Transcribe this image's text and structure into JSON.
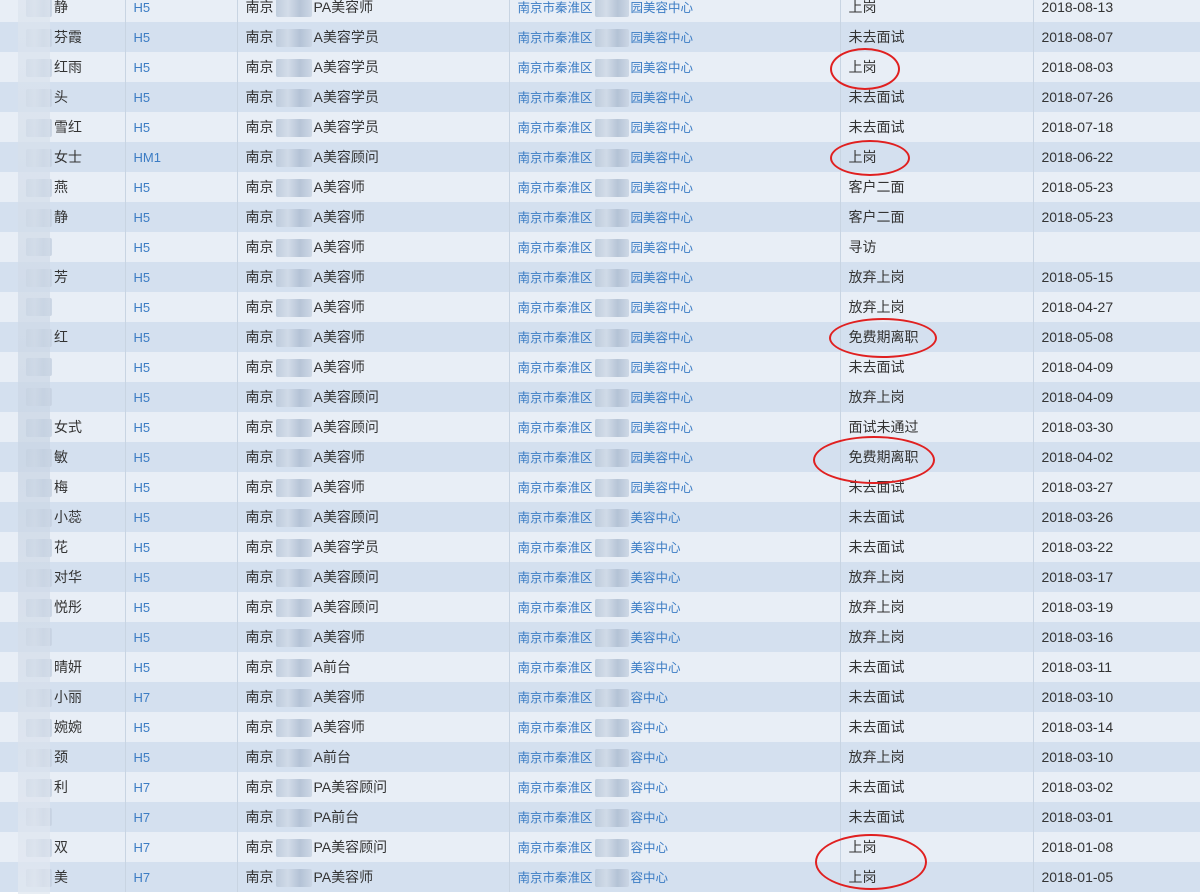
{
  "table": {
    "rows": [
      {
        "name": "静",
        "code": "H5",
        "pos_a": "南京",
        "pos_b": "PA美容师",
        "store_a": "南京市秦淮区",
        "store_b": "园美容中心",
        "status": "上岗",
        "date": "2018-08-13"
      },
      {
        "name": "芬霞",
        "code": "H5",
        "pos_a": "南京",
        "pos_b": "A美容学员",
        "store_a": "南京市秦淮区",
        "store_b": "园美容中心",
        "status": "未去面试",
        "date": "2018-08-07"
      },
      {
        "name": "红雨",
        "code": "H5",
        "pos_a": "南京",
        "pos_b": "A美容学员",
        "store_a": "南京市秦淮区",
        "store_b": "园美容中心",
        "status": "上岗",
        "date": "2018-08-03"
      },
      {
        "name": "头",
        "code": "H5",
        "pos_a": "南京",
        "pos_b": "A美容学员",
        "store_a": "南京市秦淮区",
        "store_b": "园美容中心",
        "status": "未去面试",
        "date": "2018-07-26"
      },
      {
        "name": "雪红",
        "code": "H5",
        "pos_a": "南京",
        "pos_b": "A美容学员",
        "store_a": "南京市秦淮区",
        "store_b": "园美容中心",
        "status": "未去面试",
        "date": "2018-07-18"
      },
      {
        "name": "女士",
        "code": "HM1",
        "pos_a": "南京",
        "pos_b": "A美容顾问",
        "store_a": "南京市秦淮区",
        "store_b": "园美容中心",
        "status": "上岗",
        "date": "2018-06-22"
      },
      {
        "name": "燕",
        "code": "H5",
        "pos_a": "南京",
        "pos_b": "A美容师",
        "store_a": "南京市秦淮区",
        "store_b": "园美容中心",
        "status": "客户二面",
        "date": "2018-05-23"
      },
      {
        "name": "静",
        "code": "H5",
        "pos_a": "南京",
        "pos_b": "A美容师",
        "store_a": "南京市秦淮区",
        "store_b": "园美容中心",
        "status": "客户二面",
        "date": "2018-05-23"
      },
      {
        "name": "",
        "code": "H5",
        "pos_a": "南京",
        "pos_b": "A美容师",
        "store_a": "南京市秦淮区",
        "store_b": "园美容中心",
        "status": "寻访",
        "date": ""
      },
      {
        "name": "芳",
        "code": "H5",
        "pos_a": "南京",
        "pos_b": "A美容师",
        "store_a": "南京市秦淮区",
        "store_b": "园美容中心",
        "status": "放弃上岗",
        "date": "2018-05-15"
      },
      {
        "name": "",
        "code": "H5",
        "pos_a": "南京",
        "pos_b": "A美容师",
        "store_a": "南京市秦淮区",
        "store_b": "园美容中心",
        "status": "放弃上岗",
        "date": "2018-04-27"
      },
      {
        "name": "红",
        "code": "H5",
        "pos_a": "南京",
        "pos_b": "A美容师",
        "store_a": "南京市秦淮区",
        "store_b": "园美容中心",
        "status": "免费期离职",
        "date": "2018-05-08"
      },
      {
        "name": "",
        "code": "H5",
        "pos_a": "南京",
        "pos_b": "A美容师",
        "store_a": "南京市秦淮区",
        "store_b": "园美容中心",
        "status": "未去面试",
        "date": "2018-04-09"
      },
      {
        "name": "",
        "code": "H5",
        "pos_a": "南京",
        "pos_b": "A美容顾问",
        "store_a": "南京市秦淮区",
        "store_b": "园美容中心",
        "status": "放弃上岗",
        "date": "2018-04-09"
      },
      {
        "name": "女式",
        "code": "H5",
        "pos_a": "南京",
        "pos_b": "A美容顾问",
        "store_a": "南京市秦淮区",
        "store_b": "园美容中心",
        "status": "面试未通过",
        "date": "2018-03-30"
      },
      {
        "name": "敏",
        "code": "H5",
        "pos_a": "南京",
        "pos_b": "A美容师",
        "store_a": "南京市秦淮区",
        "store_b": "园美容中心",
        "status": "免费期离职",
        "date": "2018-04-02"
      },
      {
        "name": "梅",
        "code": "H5",
        "pos_a": "南京",
        "pos_b": "A美容师",
        "store_a": "南京市秦淮区",
        "store_b": "园美容中心",
        "status": "未去面试",
        "date": "2018-03-27"
      },
      {
        "name": "小蕊",
        "code": "H5",
        "pos_a": "南京",
        "pos_b": "A美容顾问",
        "store_a": "南京市秦淮区",
        "store_b": "美容中心",
        "status": "未去面试",
        "date": "2018-03-26"
      },
      {
        "name": "花",
        "code": "H5",
        "pos_a": "南京",
        "pos_b": "A美容学员",
        "store_a": "南京市秦淮区",
        "store_b": "美容中心",
        "status": "未去面试",
        "date": "2018-03-22"
      },
      {
        "name": "对华",
        "code": "H5",
        "pos_a": "南京",
        "pos_b": "A美容顾问",
        "store_a": "南京市秦淮区",
        "store_b": "美容中心",
        "status": "放弃上岗",
        "date": "2018-03-17"
      },
      {
        "name": "悦彤",
        "code": "H5",
        "pos_a": "南京",
        "pos_b": "A美容顾问",
        "store_a": "南京市秦淮区",
        "store_b": "美容中心",
        "status": "放弃上岗",
        "date": "2018-03-19"
      },
      {
        "name": "",
        "code": "H5",
        "pos_a": "南京",
        "pos_b": "A美容师",
        "store_a": "南京市秦淮区",
        "store_b": "美容中心",
        "status": "放弃上岗",
        "date": "2018-03-16"
      },
      {
        "name": "晴妍",
        "code": "H5",
        "pos_a": "南京",
        "pos_b": "A前台",
        "store_a": "南京市秦淮区",
        "store_b": "美容中心",
        "status": "未去面试",
        "date": "2018-03-11"
      },
      {
        "name": "小丽",
        "code": "H7",
        "pos_a": "南京",
        "pos_b": "A美容师",
        "store_a": "南京市秦淮区",
        "store_b": "容中心",
        "status": "未去面试",
        "date": "2018-03-10"
      },
      {
        "name": "婉婉",
        "code": "H5",
        "pos_a": "南京",
        "pos_b": "A美容师",
        "store_a": "南京市秦淮区",
        "store_b": "容中心",
        "status": "未去面试",
        "date": "2018-03-14"
      },
      {
        "name": "颈",
        "code": "H5",
        "pos_a": "南京",
        "pos_b": "A前台",
        "store_a": "南京市秦淮区",
        "store_b": "容中心",
        "status": "放弃上岗",
        "date": "2018-03-10"
      },
      {
        "name": "利",
        "code": "H7",
        "pos_a": "南京",
        "pos_b": "PA美容顾问",
        "store_a": "南京市秦淮区",
        "store_b": "容中心",
        "status": "未去面试",
        "date": "2018-03-02"
      },
      {
        "name": "",
        "code": "H7",
        "pos_a": "南京",
        "pos_b": "PA前台",
        "store_a": "南京市秦淮区",
        "store_b": "容中心",
        "status": "未去面试",
        "date": "2018-03-01"
      },
      {
        "name": "双",
        "code": "H7",
        "pos_a": "南京",
        "pos_b": "PA美容顾问",
        "store_a": "南京市秦淮区",
        "store_b": "容中心",
        "status": "上岗",
        "date": "2018-01-08"
      },
      {
        "name": "美",
        "code": "H7",
        "pos_a": "南京",
        "pos_b": "PA美容师",
        "store_a": "南京市秦淮区",
        "store_b": "容中心",
        "status": "上岗",
        "date": "2018-01-05"
      }
    ]
  }
}
